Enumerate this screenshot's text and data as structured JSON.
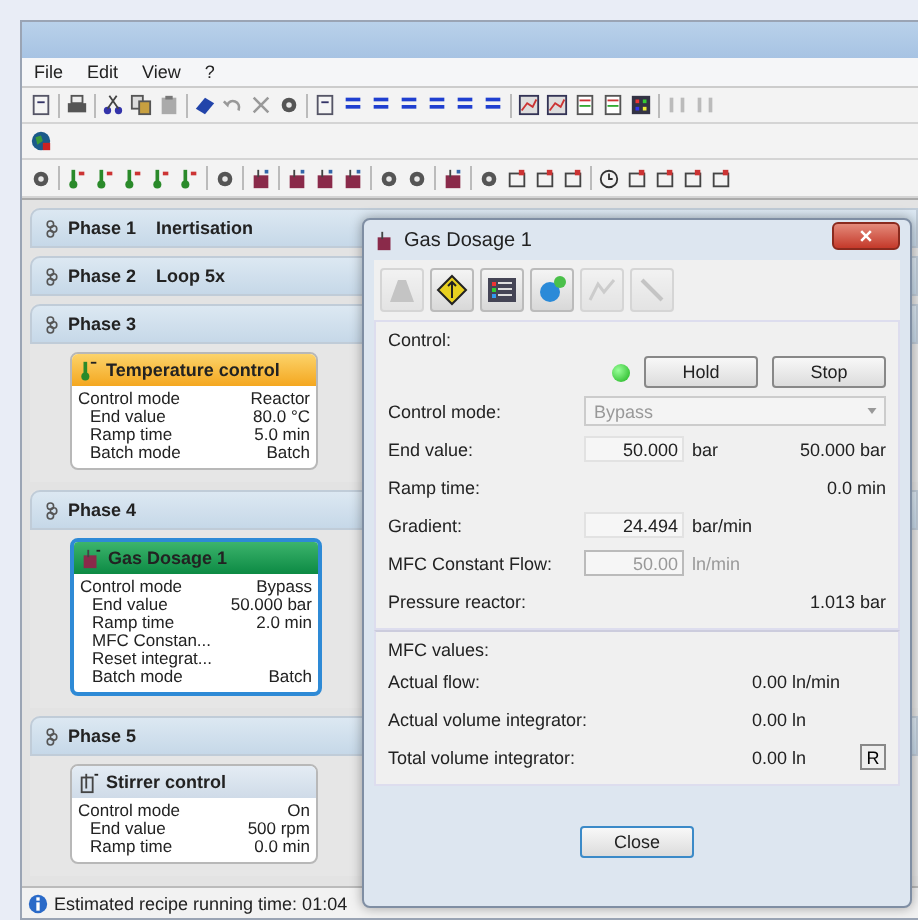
{
  "menu": [
    "File",
    "Edit",
    "View",
    "?"
  ],
  "phases": [
    {
      "label": "Phase 1",
      "name": "Inertisation"
    },
    {
      "label": "Phase 2",
      "name": "Loop 5x"
    },
    {
      "label": "Phase 3",
      "step": {
        "kind": "temperature",
        "title": "Temperature control",
        "selected": false,
        "rows": [
          {
            "label": "Control mode",
            "value": "Reactor"
          },
          {
            "label": "End value",
            "value": "80.0 °C"
          },
          {
            "label": "Ramp time",
            "value": "5.0 min"
          },
          {
            "label": "Batch mode",
            "value": "Batch"
          }
        ]
      }
    },
    {
      "label": "Phase 4",
      "step": {
        "kind": "gas",
        "title": "Gas Dosage 1",
        "selected": true,
        "rows": [
          {
            "label": "Control mode",
            "value": "Bypass"
          },
          {
            "label": "End value",
            "value": "50.000 bar"
          },
          {
            "label": "Ramp time",
            "value": "2.0 min"
          },
          {
            "label": "MFC Constan..."
          },
          {
            "label": "Reset integrat..."
          },
          {
            "label": "Batch mode",
            "value": "Batch"
          }
        ]
      }
    },
    {
      "label": "Phase 5",
      "step": {
        "kind": "stirrer",
        "title": "Stirrer control",
        "selected": false,
        "rows": [
          {
            "label": "Control mode",
            "value": "On"
          },
          {
            "label": "End value",
            "value": "500 rpm"
          },
          {
            "label": "Ramp time",
            "value": "0.0 min"
          }
        ]
      }
    }
  ],
  "status_bar": {
    "text": "Estimated recipe running time: 01:04"
  },
  "dialog": {
    "title": "Gas Dosage 1",
    "tool_buttons": [
      {
        "disabled": true
      },
      {
        "disabled": false
      },
      {
        "disabled": false
      },
      {
        "disabled": false
      },
      {
        "disabled": true
      },
      {
        "disabled": true
      }
    ],
    "control": {
      "title": "Control:",
      "running": true,
      "buttons": [
        "Hold",
        "Stop"
      ],
      "rows": [
        {
          "kind": "dropdown",
          "label": "Control mode:",
          "value": "Bypass",
          "disabled": true
        },
        {
          "kind": "input",
          "label": "End value:",
          "value": "50.000",
          "unit": "bar",
          "reading": "50.000 bar",
          "disabled": false
        },
        {
          "kind": "reading",
          "label": "Ramp time:",
          "reading": "0.0 min"
        },
        {
          "kind": "input",
          "label": "Gradient:",
          "value": "24.494",
          "unit": "bar/min",
          "disabled": false
        },
        {
          "kind": "input",
          "label": "MFC Constant Flow:",
          "value": "50.00",
          "unit": "ln/min",
          "disabled": true
        },
        {
          "kind": "reading",
          "label": "Pressure reactor:",
          "reading": "1.013 bar"
        }
      ]
    },
    "mfc": {
      "title": "MFC values:",
      "rows": [
        {
          "label": "Actual flow:",
          "reading": "0.00 ln/min"
        },
        {
          "label": "Actual volume integrator:",
          "reading": "0.00 ln"
        },
        {
          "label": "Total volume integrator:",
          "reading": "0.00 ln",
          "button": "R"
        }
      ]
    },
    "close": "Close"
  }
}
